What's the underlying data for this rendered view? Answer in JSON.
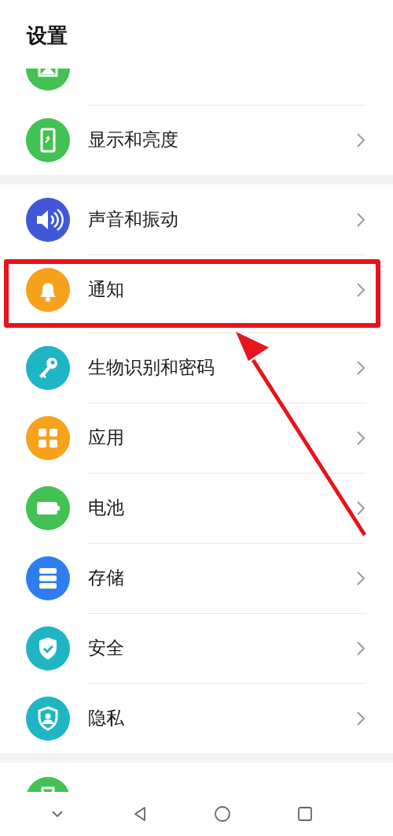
{
  "title": "设置",
  "groups": [
    {
      "items": [
        {
          "kind": "wallpaper",
          "color": "#43c152"
        },
        {
          "label": "显示和亮度",
          "kind": "display",
          "color": "#43c152",
          "highlighted": false
        }
      ]
    },
    {
      "items": [
        {
          "label": "声音和振动",
          "kind": "sound",
          "color": "#4058d8",
          "highlighted": false
        },
        {
          "label": "通知",
          "kind": "bell",
          "color": "#f7a21b",
          "highlighted": true
        },
        {
          "label": "生物识别和密码",
          "kind": "key",
          "color": "#1fb5c4",
          "highlighted": false
        },
        {
          "label": "应用",
          "kind": "apps",
          "color": "#f7a21b",
          "highlighted": false
        },
        {
          "label": "电池",
          "kind": "battery",
          "color": "#43c152",
          "highlighted": false
        },
        {
          "label": "存储",
          "kind": "storage",
          "color": "#2f7ef0",
          "highlighted": false
        },
        {
          "label": "安全",
          "kind": "shield",
          "color": "#1fb5c4",
          "highlighted": false
        },
        {
          "label": "隐私",
          "kind": "privacy",
          "color": "#1fb5c4",
          "highlighted": false
        }
      ]
    },
    {
      "items": [
        {
          "kind": "health",
          "color": "#43c152"
        }
      ]
    }
  ]
}
